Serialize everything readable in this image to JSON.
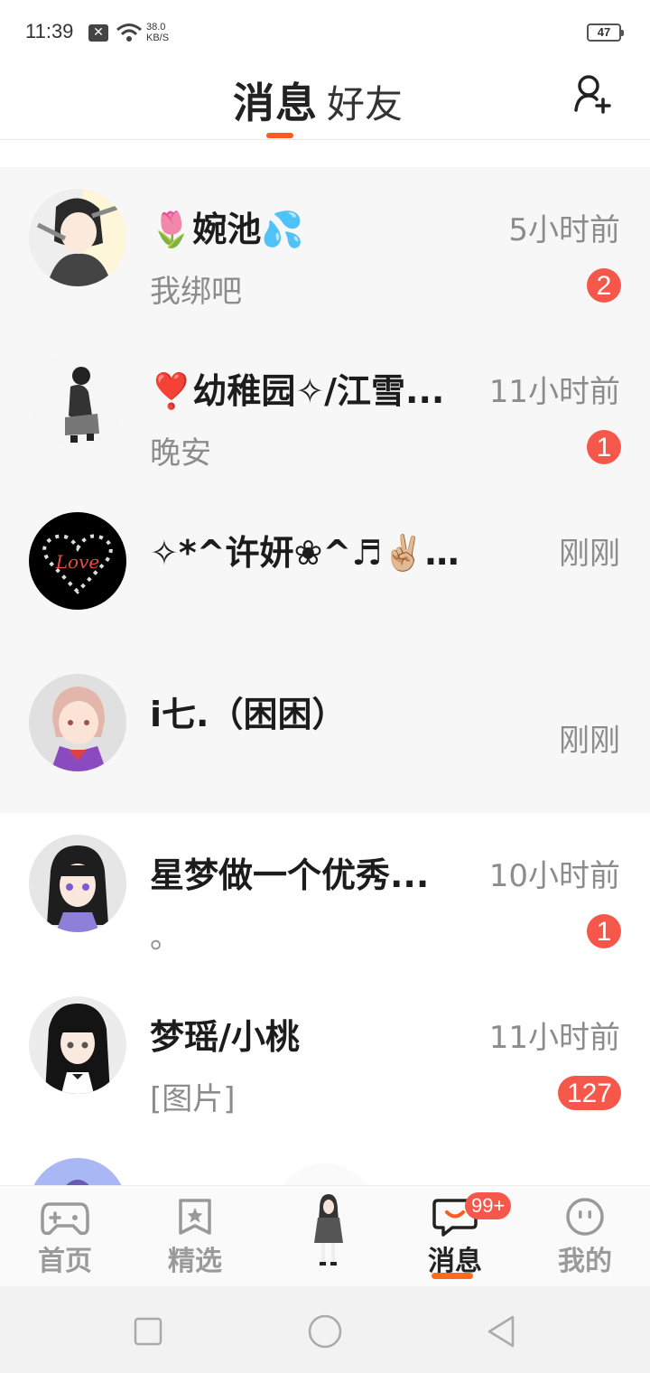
{
  "status_bar": {
    "time": "11:39",
    "speed_value": "38.0",
    "speed_unit": "KB/S",
    "battery": "47"
  },
  "header": {
    "tab_messages": "消息",
    "tab_friends": "好友",
    "add_friend_icon": "add-user-icon"
  },
  "conversations": [
    {
      "name": "🌷婉池💦",
      "time": "5小时前",
      "preview": "我绑吧",
      "badge": "2",
      "pinned": true
    },
    {
      "name": "❣️幼稚园✧/江雪...",
      "time": "11小时前",
      "preview": "晚安",
      "badge": "1",
      "pinned": true
    },
    {
      "name": "✧*^许妍❀^♬✌🏼『悲...",
      "time": "刚刚",
      "preview": "",
      "badge": "",
      "pinned": true
    },
    {
      "name": "i七.（困困）",
      "time": "刚刚",
      "preview": "",
      "badge": "",
      "pinned": true
    },
    {
      "name": "星梦做一个优秀...",
      "time": "10小时前",
      "preview": "。",
      "badge": "1",
      "pinned": false
    },
    {
      "name": "梦瑶/小桃",
      "time": "11小时前",
      "preview": "[图片]",
      "badge": "127",
      "pinned": false
    }
  ],
  "bottom_nav": {
    "items": [
      {
        "label": "首页",
        "icon": "gamepad-icon"
      },
      {
        "label": "精选",
        "icon": "star-icon"
      },
      {
        "label": "消息",
        "icon": "chat-icon",
        "active": true
      },
      {
        "label": "我的",
        "icon": "face-icon"
      }
    ],
    "message_badge": "99+"
  },
  "colors": {
    "accent": "#ff5a1f",
    "badge": "#f5584a",
    "pinned_bg": "#f7f7f7"
  }
}
